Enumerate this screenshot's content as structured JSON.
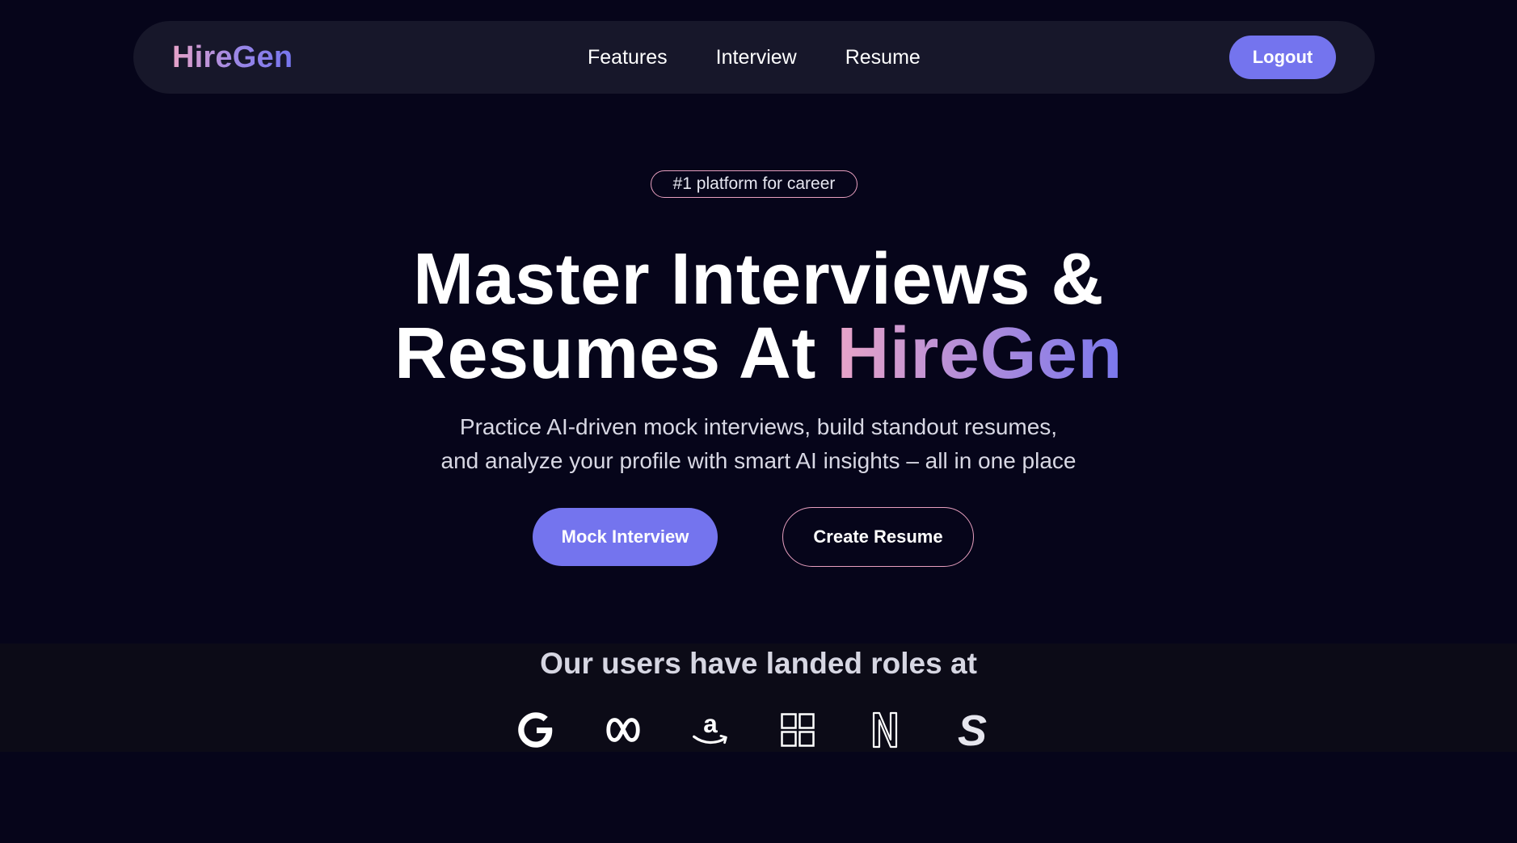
{
  "nav": {
    "brand": "HireGen",
    "links": [
      "Features",
      "Interview",
      "Resume"
    ],
    "logout_label": "Logout"
  },
  "hero": {
    "badge": "#1 platform for career",
    "title_line1": "Master Interviews &",
    "title_line2_prefix": "Resumes At ",
    "title_line2_accent": "HireGen",
    "subtitle_line1": "Practice AI-driven mock interviews, build standout resumes,",
    "subtitle_line2": "and analyze your profile with smart AI insights – all in one place",
    "primary_cta": "Mock Interview",
    "secondary_cta": "Create Resume"
  },
  "companies": {
    "heading": "Our users have landed roles at",
    "logos": [
      "google-icon",
      "meta-icon",
      "amazon-icon",
      "microsoft-icon",
      "netflix-icon",
      "stripe-icon"
    ]
  },
  "colors": {
    "background": "#06051a",
    "navbar": "#17172a",
    "accent": "#7474ee",
    "outline_pink": "#e79fbf",
    "strip": "#0c0b17"
  }
}
